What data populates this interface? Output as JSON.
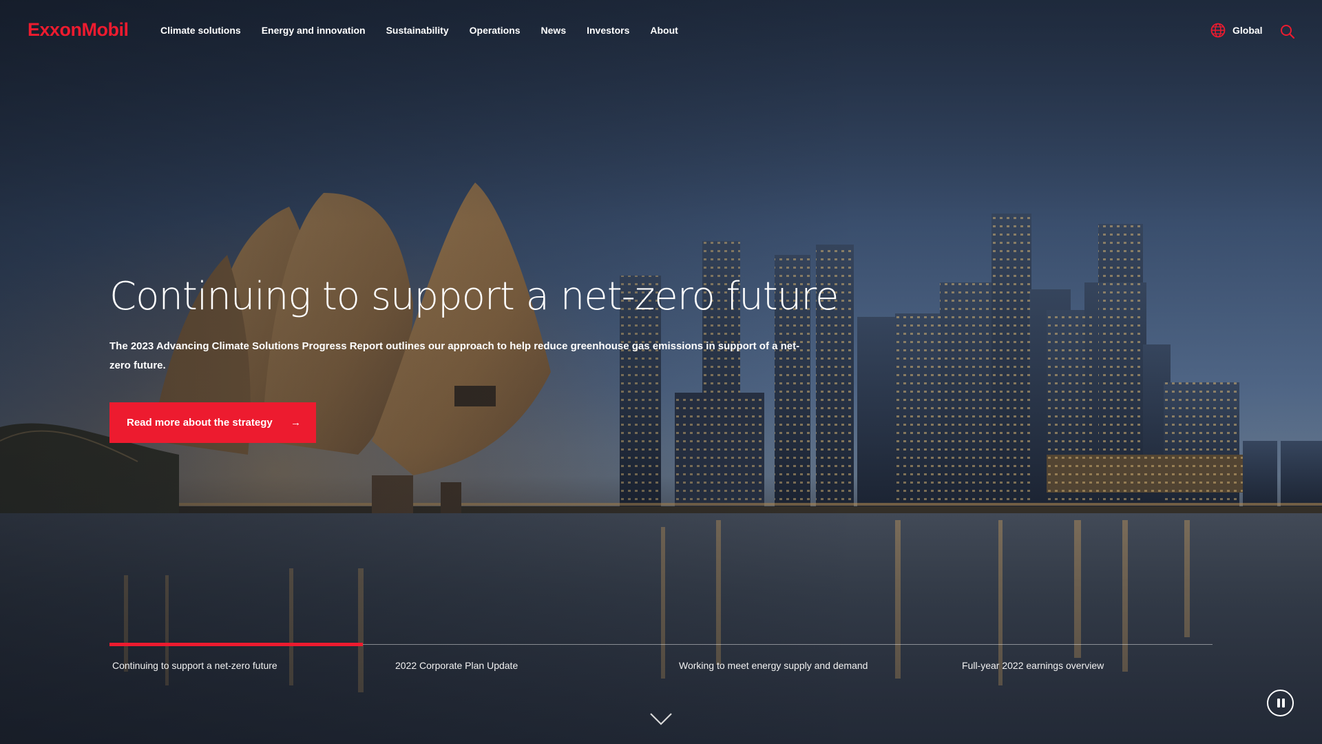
{
  "brand": {
    "logo_text": "ExxonMobil",
    "accent_color": "#ed1b2f"
  },
  "nav": {
    "items": [
      {
        "label": "Climate solutions"
      },
      {
        "label": "Energy and innovation"
      },
      {
        "label": "Sustainability"
      },
      {
        "label": "Operations"
      },
      {
        "label": "News"
      },
      {
        "label": "Investors"
      },
      {
        "label": "About"
      }
    ],
    "region_label": "Global",
    "region_icon": "globe-icon",
    "search_icon": "search-icon"
  },
  "hero": {
    "title": "Continuing to support a net-zero future",
    "description": "The 2023 Advancing Climate Solutions Progress Report outlines our approach to help reduce greenhouse gas emissions in support of a net-zero future.",
    "cta_label": "Read more about the strategy",
    "cta_icon": "arrow-right-icon"
  },
  "carousel": {
    "active_index": 0,
    "active_progress": 0.23,
    "slides": [
      {
        "label": "Continuing to support a net-zero future"
      },
      {
        "label": "2022 Corporate Plan Update"
      },
      {
        "label": "Working to meet energy supply and demand"
      },
      {
        "label": "Full-year 2022 earnings overview"
      }
    ],
    "pause_icon": "pause-icon",
    "scroll_icon": "chevron-down-icon"
  }
}
